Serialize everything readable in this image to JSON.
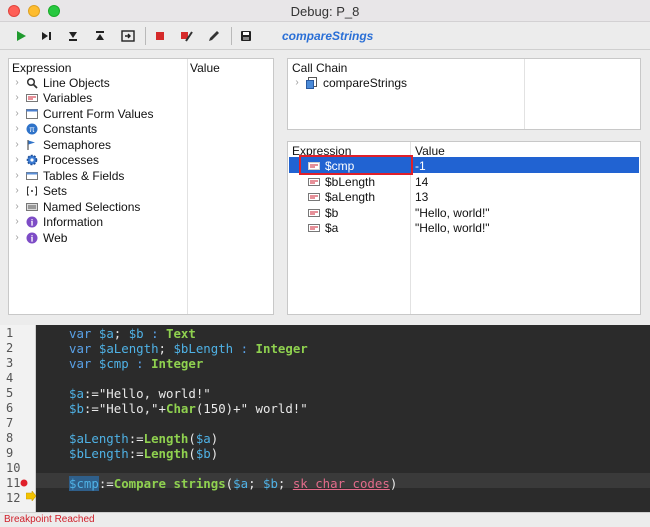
{
  "window": {
    "title": "Debug: P_8"
  },
  "toolbar": {
    "buttons": [
      {
        "icon": "play-icon"
      },
      {
        "icon": "step-over-icon"
      },
      {
        "icon": "step-into-icon"
      },
      {
        "icon": "step-out-icon"
      },
      {
        "icon": "abort-icon"
      },
      {
        "icon": "stop-icon"
      },
      {
        "icon": "breakpoint-edit-icon"
      },
      {
        "icon": "pencil-icon"
      },
      {
        "icon": "save-icon"
      }
    ],
    "method": "compareStrings"
  },
  "expression_panel": {
    "col_expression": "Expression",
    "col_value": "Value",
    "items": [
      {
        "label": "Line Objects",
        "icon": "magnifier-icon"
      },
      {
        "label": "Variables",
        "icon": "variable-icon"
      },
      {
        "label": "Current Form Values",
        "icon": "form-icon"
      },
      {
        "label": "Constants",
        "icon": "constant-icon"
      },
      {
        "label": "Semaphores",
        "icon": "flag-icon"
      },
      {
        "label": "Processes",
        "icon": "gear-icon"
      },
      {
        "label": "Tables & Fields",
        "icon": "table-icon"
      },
      {
        "label": "Sets",
        "icon": "set-icon"
      },
      {
        "label": "Named Selections",
        "icon": "selection-icon"
      },
      {
        "label": "Information",
        "icon": "info-icon"
      },
      {
        "label": "Web",
        "icon": "web-icon"
      }
    ]
  },
  "call_chain": {
    "header": "Call Chain",
    "items": [
      {
        "label": "compareStrings",
        "icon": "method-icon"
      }
    ]
  },
  "locals": {
    "col_expression": "Expression",
    "col_value": "Value",
    "rows": [
      {
        "name": "$cmp",
        "value": "-1",
        "selected": true
      },
      {
        "name": "$bLength",
        "value": "14"
      },
      {
        "name": "$aLength",
        "value": "13"
      },
      {
        "name": "$b",
        "value": "\"Hello, world!\""
      },
      {
        "name": "$a",
        "value": "\"Hello, world!\""
      }
    ]
  },
  "code": {
    "line_numbers": [
      "1",
      "2",
      "3",
      "4",
      "5",
      "6",
      "7",
      "8",
      "9",
      "10",
      "11",
      "12"
    ],
    "l1": {
      "kw": "var",
      "a": "$a",
      "sep": "; ",
      "b": "$b",
      "colon": " : ",
      "type": "Text"
    },
    "l2": {
      "kw": "var",
      "a": "$aLength",
      "sep": "; ",
      "b": "$bLength",
      "colon": " : ",
      "type": "Integer"
    },
    "l3": {
      "kw": "var",
      "a": "$cmp",
      "colon": " : ",
      "type": "Integer"
    },
    "l5": {
      "var": "$a",
      "rest": ":=\"Hello, world!\""
    },
    "l6": {
      "var": "$b",
      "p1": ":=\"Hello,\"+",
      "fn": "Char",
      "p2": "(150)+\" world!\""
    },
    "l8": {
      "var": "$aLength",
      "op": ":=",
      "fn": "Length",
      "lp": "(",
      "arg": "$a",
      "rp": ")"
    },
    "l9": {
      "var": "$bLength",
      "op": ":=",
      "fn": "Length",
      "lp": "(",
      "arg": "$b",
      "rp": ")"
    },
    "l11": {
      "var": "$cmp",
      "op": ":=",
      "fn": "Compare strings",
      "lp": "(",
      "a": "$a",
      "s1": "; ",
      "b": "$b",
      "s2": "; ",
      "c": "sk char codes",
      "rp": ")"
    }
  },
  "status": {
    "text": "Breakpoint Reached"
  }
}
